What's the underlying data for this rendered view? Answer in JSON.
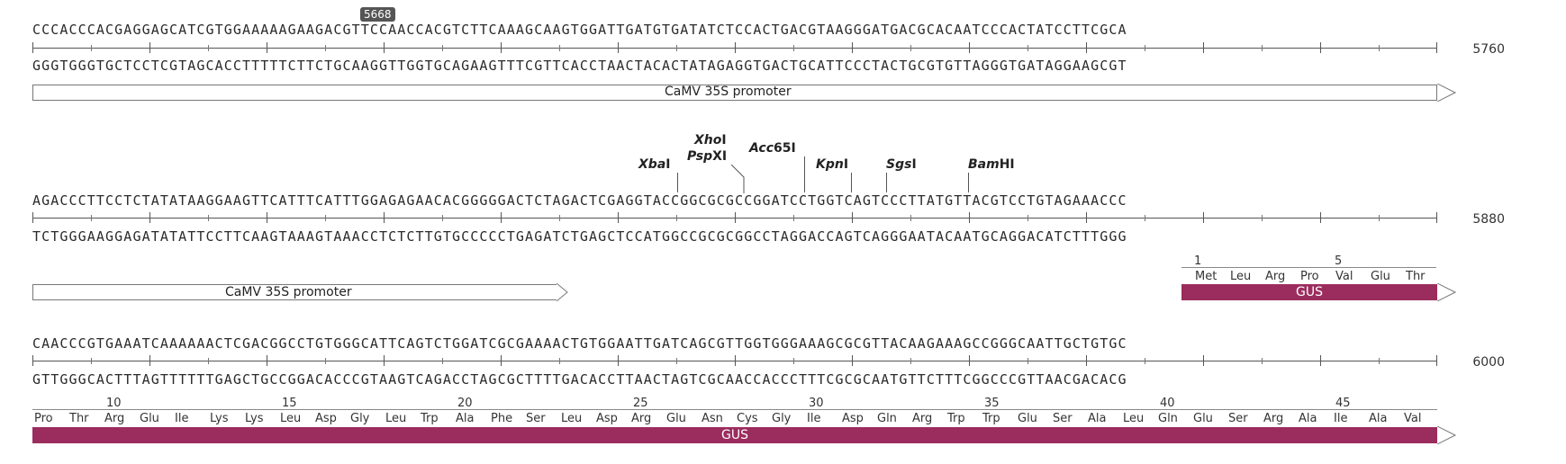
{
  "rows": [
    {
      "top": "CCCACCCACGAGGAGCATCGTGGAAAAAGAAGACGTTCCAACCACGTCTTCAAAGCAAGTGGATTGATGTGATATCTCCACTGACGTAAGGGATGACGCACAATCCCACTATCCTTCGCA",
      "bottom": "GGGTGGGTGCTCCTCGTAGCACCTTTTTCTTCTGCAAGGTTGGTGCAGAAGTTTCGTTCACCTAACTACACTATAGAGGTGACTGCATTCCCTACTGCGTGTTAGGGTGATAGGAAGCGT",
      "position": "5760",
      "badge": "5668",
      "feature_label": "CaMV 35S promoter"
    },
    {
      "top": "AGACCCTTCCTCTATATAAGGAAGTTCATTTCATTTGGAGAGAACACGGGGGACTCTAGACTCGAGGTACCGGCGCGCCGGATCCTGGTCAGTCCCTTATGTTACGTCCTGTAGAAACCC",
      "bottom": "TCTGGGAAGGAGATATATTCCTTCAAGTAAAGTAAACCTCTCTTGTGCCCCCTGAGATCTGAGCTCCATGGCCGCGCGGCCTAGGACCAGTCAGGGAATACAATGCAGGACATCTTTGGG",
      "position": "5880",
      "feature_label": "CaMV 35S promoter",
      "gus_label": "GUS",
      "enzymes": [
        {
          "name_italic": "Xba",
          "name_rest": "I"
        },
        {
          "name_italic": "Xho",
          "name_rest": "I"
        },
        {
          "name_italic": "Psp",
          "name_rest": "XI"
        },
        {
          "name_italic": "Acc",
          "name_rest": "65I"
        },
        {
          "name_italic": "Kpn",
          "name_rest": "I"
        },
        {
          "name_italic": "Sgs",
          "name_rest": "I"
        },
        {
          "name_italic": "Bam",
          "name_rest": "HI"
        }
      ],
      "aa_numbers": [
        "1",
        "5"
      ],
      "amino_acids": [
        "Met",
        "Leu",
        "Arg",
        "Pro",
        "Val",
        "Glu",
        "Thr"
      ]
    },
    {
      "top": "CAACCCGTGAAATCAAAAAACTCGACGGCCTGTGGGCATTCAGTCTGGATCGCGAAAACTGTGGAATTGATCAGCGTTGGTGGGAAAGCGCGTTACAAGAAAGCCGGGCAATTGCTGTGC",
      "bottom": "GTTGGGCACTTTAGTTTTTTGAGCTGCCGGACACCCGTAAGTCAGACCTAGCGCTTTTGACACCTTAACTAGTCGCAACCACCCTTTCGCGCAATGTTCTTTCGGCCCGTTAACGACACG",
      "position": "6000",
      "gus_label": "GUS",
      "aa_numbers": [
        "10",
        "15",
        "20",
        "25",
        "30",
        "35",
        "40",
        "45"
      ],
      "amino_acids": [
        "Pro",
        "Thr",
        "Arg",
        "Glu",
        "Ile",
        "Lys",
        "Lys",
        "Leu",
        "Asp",
        "Gly",
        "Leu",
        "Trp",
        "Ala",
        "Phe",
        "Ser",
        "Leu",
        "Asp",
        "Arg",
        "Glu",
        "Asn",
        "Cys",
        "Gly",
        "Ile",
        "Asp",
        "Gln",
        "Arg",
        "Trp",
        "Trp",
        "Glu",
        "Ser",
        "Ala",
        "Leu",
        "Gln",
        "Glu",
        "Ser",
        "Arg",
        "Ala",
        "Ile",
        "Ala",
        "Val"
      ]
    }
  ],
  "colors": {
    "gus_feature": "#9b2d5e",
    "promoter_fill": "#ffffff"
  }
}
